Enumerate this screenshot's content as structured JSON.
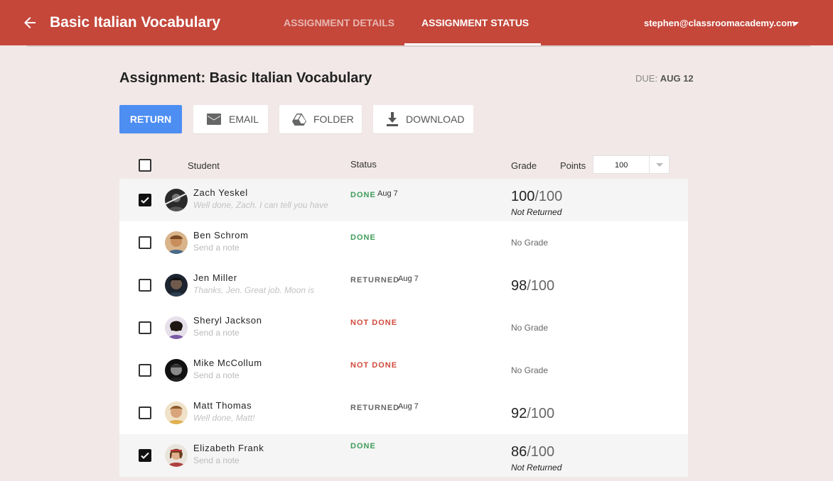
{
  "header": {
    "app_title": "Basic Italian Vocabulary",
    "tabs": [
      {
        "label": "ASSIGNMENT DETAILS",
        "active": false
      },
      {
        "label": "ASSIGNMENT STATUS",
        "active": true
      }
    ],
    "account": "stephen@classroomacademy.com",
    "icons": {
      "back": "arrow-back-icon",
      "account_menu": "caret-down-icon"
    },
    "colors": {
      "brand": "#c4473a",
      "accent": "#4d8ef3",
      "done": "#3f9c5a",
      "not_done": "#d04a3c"
    }
  },
  "page": {
    "title": "Assignment: Basic Italian Vocabulary",
    "due_label": "DUE:",
    "due_date": "AUG 12"
  },
  "toolbar": {
    "return_label": "RETURN",
    "email_label": "EMAIL",
    "folder_label": "FOLDER",
    "download_label": "DOWNLOAD",
    "icons": {
      "email": "mail-icon",
      "folder": "drive-icon",
      "download": "download-icon"
    }
  },
  "table": {
    "headers": {
      "student": "Student",
      "status": "Status",
      "grade": "Grade",
      "points": "Points"
    },
    "points_value": "100",
    "rows": [
      {
        "name": "Zach Yeskel",
        "note": "Well done, Zach. I can tell you have",
        "status": "DONE",
        "date": "Aug 7",
        "grade": "100",
        "out_of": "/100",
        "grade_note": "Not Returned",
        "selected": true
      },
      {
        "name": "Ben Schrom",
        "note": "Send a note",
        "status": "DONE",
        "date": "",
        "grade_text": "No Grade",
        "selected": false
      },
      {
        "name": "Jen Miller",
        "note": "Thanks, Jen. Great job. Moon is",
        "status": "RETURNED",
        "date": "Aug 7",
        "grade": "98",
        "out_of": "/100",
        "selected": false
      },
      {
        "name": "Sheryl Jackson",
        "note": "Send a note",
        "status": "NOT DONE",
        "date": "",
        "grade_text": "No Grade",
        "selected": false
      },
      {
        "name": "Mike McCollum",
        "note": "Send a note",
        "status": "NOT DONE",
        "date": "",
        "grade_text": "No Grade",
        "selected": false
      },
      {
        "name": "Matt Thomas",
        "note": "Well done, Matt!",
        "status": "RETURNED",
        "date": "Aug 7",
        "grade": "92",
        "out_of": "/100",
        "selected": false
      },
      {
        "name": "Elizabeth Frank",
        "note": "Send a note",
        "status": "DONE",
        "date": "",
        "grade": "86",
        "out_of": "/100",
        "grade_note": "Not Returned",
        "selected": true
      }
    ]
  }
}
